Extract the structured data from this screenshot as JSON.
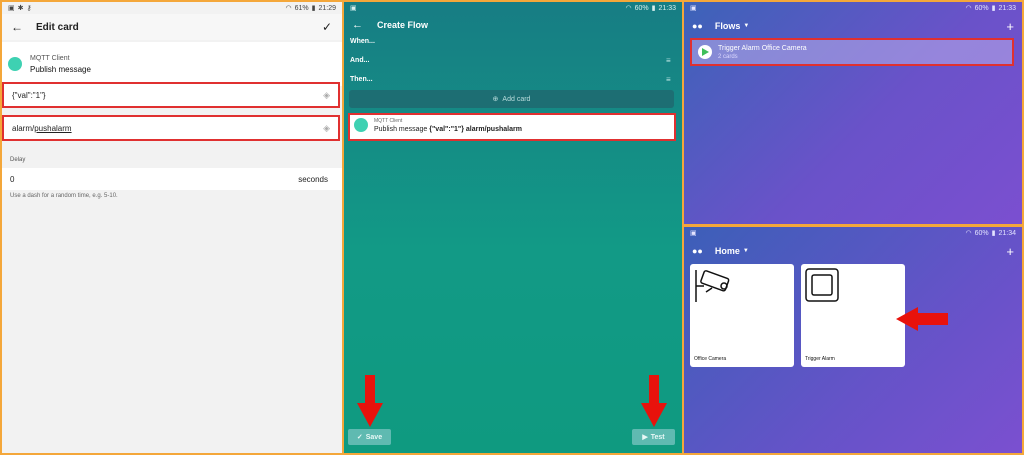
{
  "edit_card": {
    "status": {
      "time": "21:29",
      "battery": "61%"
    },
    "title": "Edit card",
    "app_name": "MQTT Client",
    "action": "Publish message",
    "message_value": "{\"val\":\"1\"}",
    "topic_prefix": "alarm/",
    "topic_underlined": "pushalarm",
    "delay_label": "Delay",
    "delay_value": "0",
    "delay_unit": "seconds",
    "delay_hint": "Use a dash for a random time, e.g. 5-10."
  },
  "create_flow": {
    "status": {
      "time": "21:33",
      "battery": "60%"
    },
    "title": "Create Flow",
    "when_label": "When...",
    "and_label": "And...",
    "then_label": "Then...",
    "add_card_label": "Add card",
    "card_app": "MQTT Client",
    "card_action_prefix": "Publish message ",
    "card_action_bold": "{\"val\":\"1\"} alarm/pushalarm",
    "save_label": "Save",
    "test_label": "Test"
  },
  "flows": {
    "status": {
      "time": "21:33",
      "battery": "60%"
    },
    "title": "Flows",
    "flow_name": "Trigger Alarm Office Camera",
    "flow_count": "2 cards"
  },
  "home": {
    "status": {
      "time": "21:34",
      "battery": "60%"
    },
    "title": "Home",
    "devices": [
      {
        "label": "Office Camera"
      },
      {
        "label": "Trigger Alarm"
      }
    ]
  },
  "colors": {
    "highlight": "#e03030",
    "teal": "#3ed1b2",
    "arrow": "#e8120c"
  }
}
